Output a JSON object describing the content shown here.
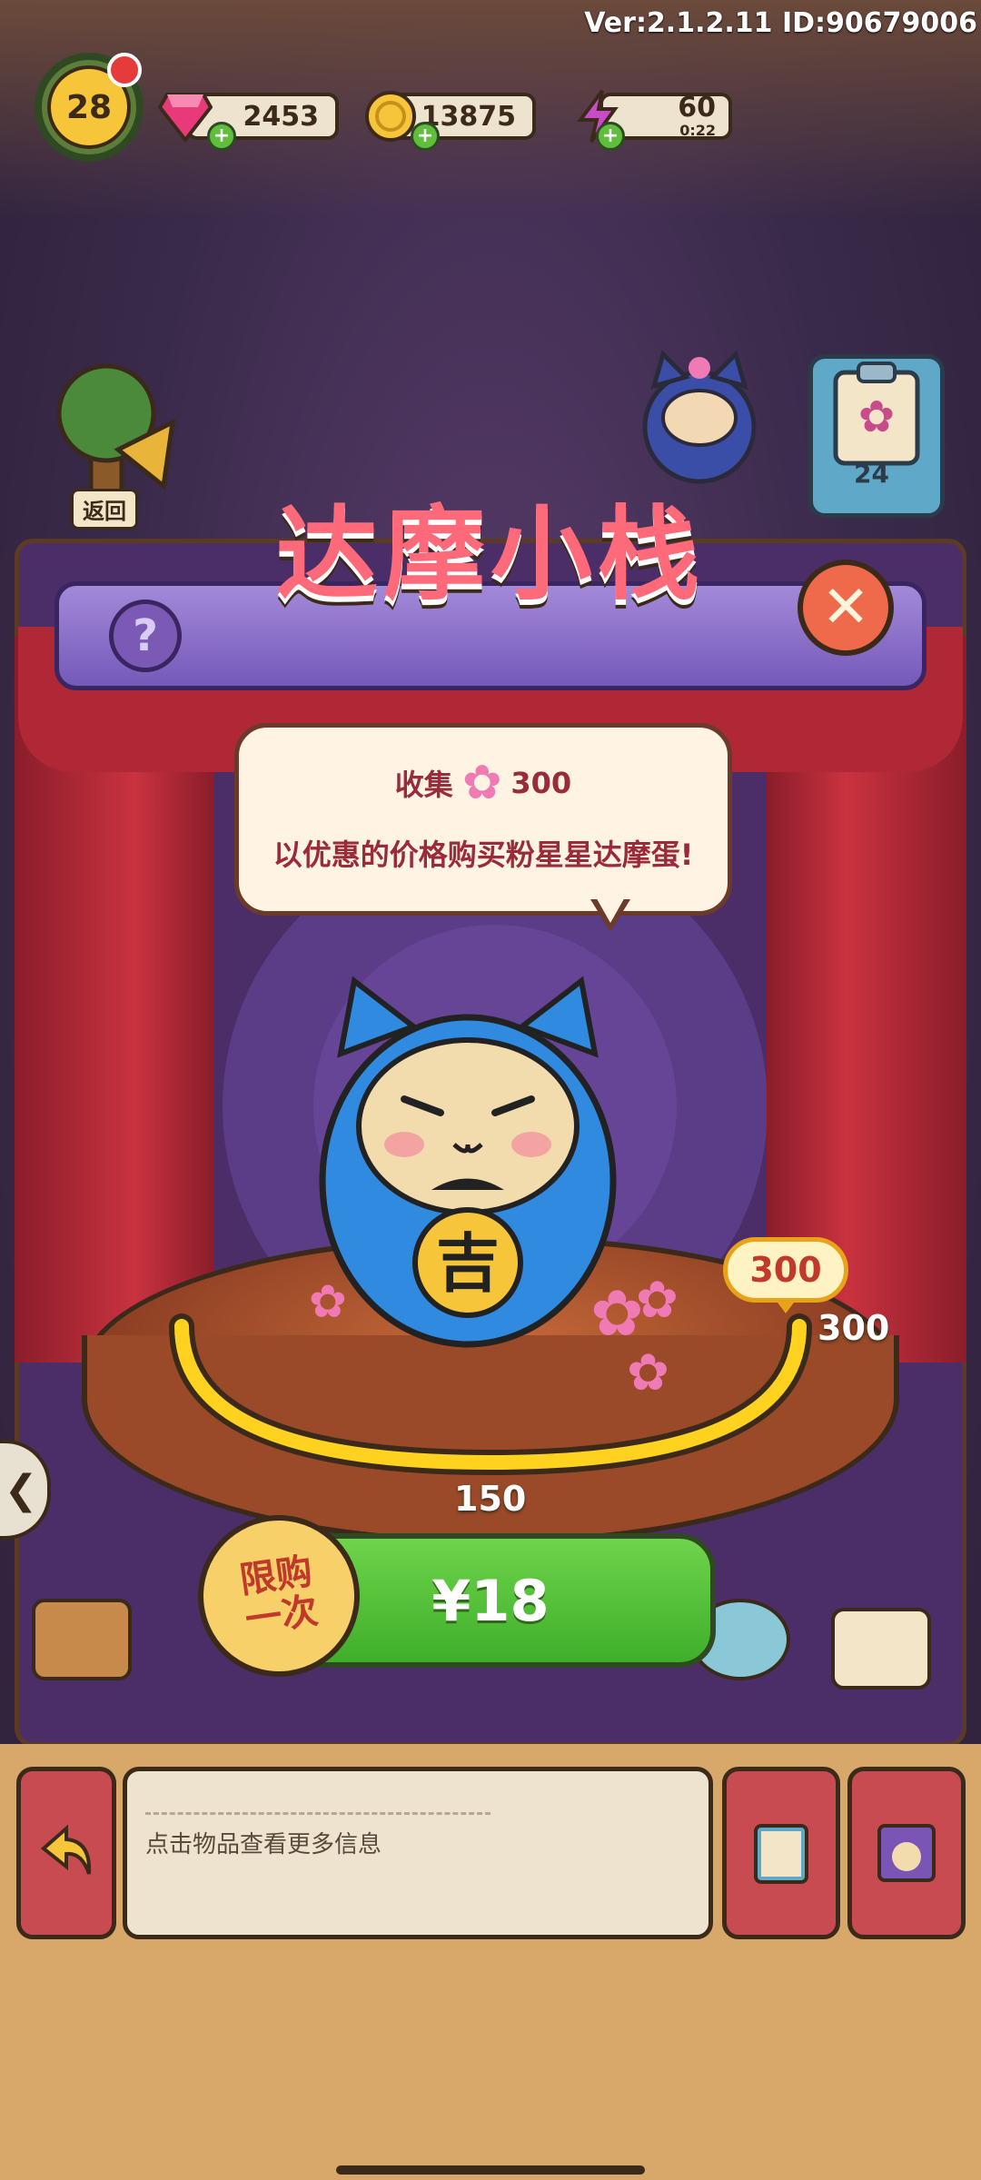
{
  "header": {
    "version_text": "Ver:2.1.2.11 ID:90679006",
    "level": "28",
    "gems": "2453",
    "coins": "13875",
    "energy": "60",
    "energy_timer": "0:22"
  },
  "side": {
    "back_label": "返回",
    "clipboard_count": "24"
  },
  "shop": {
    "title": "达摩小栈",
    "help_symbol": "?",
    "close_symbol": "✕",
    "bubble": {
      "collect_label": "收集",
      "collect_amount": "300",
      "description": "以优惠的价格购买粉星星达摩蛋!"
    },
    "daruma_char": "吉",
    "progress": {
      "current": 300,
      "current_label": "300",
      "max_label": "300",
      "mid_label": "150",
      "fraction": 1.0
    },
    "limit_tag_line1": "限购",
    "limit_tag_line2": "一次",
    "price": "¥18"
  },
  "bottom": {
    "info_text": "点击物品查看更多信息"
  },
  "colors": {
    "accent_green": "#4cc236",
    "progress_yellow": "#ffd21f",
    "title_pink": "#ff6a7a",
    "panel_purple": "#4b2e67"
  },
  "icons": [
    "gem-icon",
    "coin-icon",
    "energy-icon",
    "tree-icon",
    "clipboard-icon",
    "flower-icon",
    "close-icon",
    "help-icon",
    "back-arrow-icon",
    "book-icon",
    "cat-frame-icon"
  ]
}
